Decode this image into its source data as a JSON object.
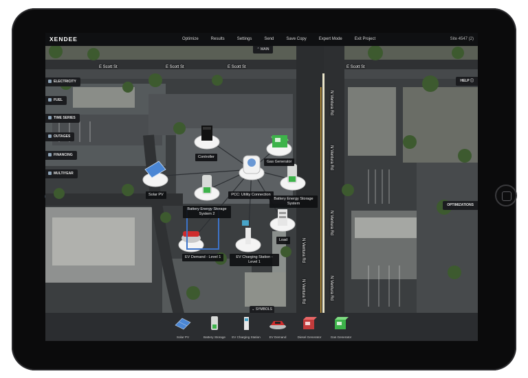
{
  "app": {
    "logo": "XENDEE",
    "site": "Site 4547 (2)"
  },
  "nav": [
    "Optimize",
    "Results",
    "Settings",
    "Send",
    "Save Copy",
    "Expert Mode",
    "Exit Project"
  ],
  "main_tab": "⌃ MAIN",
  "left_panel": [
    {
      "label": "ELECTRICITY",
      "icon": "lightning-icon"
    },
    {
      "label": "FUEL",
      "icon": "fuel-icon"
    },
    {
      "label": "TIME SERIES",
      "icon": "clock-icon"
    },
    {
      "label": "OUTAGES",
      "icon": "outage-icon"
    },
    {
      "label": "FINANCING",
      "icon": "financing-icon"
    },
    {
      "label": "MULTIYEAR",
      "icon": "calendar-icon"
    }
  ],
  "right_panel": {
    "help": "HELP ⓘ",
    "optimizations": "OPTIMIZATIONS"
  },
  "streets": {
    "scott_1": "E Scott St",
    "scott_2": "E Scott St",
    "scott_3": "E Scott St",
    "scott_4": "E Scott St",
    "ventura_1": "N Ventura Rd",
    "ventura_2": "N Ventura Rd",
    "ventura_3": "N Ventura Rd",
    "ventura_4": "N Ventura Rd",
    "ventura_5": "N Ventura Rd",
    "ventura_6": "N Ventura Rd"
  },
  "nodes": {
    "controller": "Controller",
    "gas_generator": "Gas Generator",
    "solar_pv": "Solar PV",
    "pcc": "PCC: Utility Connection",
    "bess1": "Battery Energy Storage System",
    "bess2": "Battery Energy Storage System 2",
    "load": "Load",
    "ev_demand": "EV Demand - Level 1",
    "ev_station": "EV Charging Station - Level 1"
  },
  "symbols_tab": "⌄ SYMBOLS",
  "symbols": [
    {
      "label": "Solar PV",
      "icon": "solar-panel-icon"
    },
    {
      "label": "Battery Storage",
      "icon": "battery-icon"
    },
    {
      "label": "EV Charging Station",
      "icon": "ev-charger-icon"
    },
    {
      "label": "EV Demand",
      "icon": "car-icon"
    },
    {
      "label": "Diesel Generator",
      "icon": "diesel-generator-icon"
    },
    {
      "label": "Gas Generator",
      "icon": "gas-generator-icon"
    }
  ],
  "colors": {
    "accent_selection": "#3d74c9",
    "generator_green": "#3db34a",
    "diesel_red": "#c23b3b",
    "topbar": "#0f1012"
  }
}
